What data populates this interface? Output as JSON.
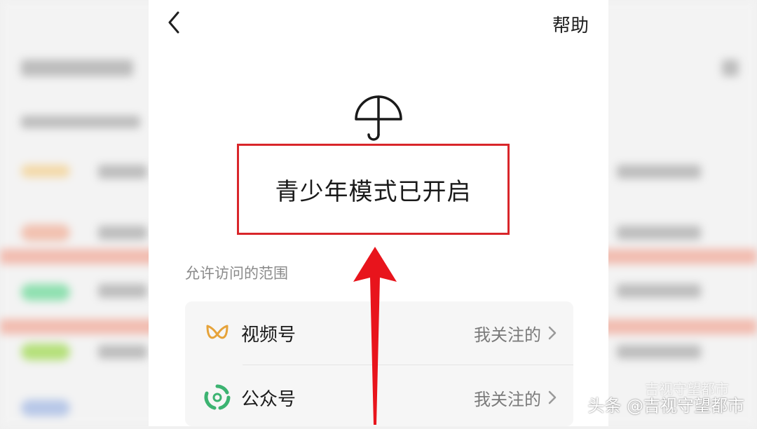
{
  "header": {
    "help_label": "帮助"
  },
  "status": {
    "text": "青少年模式已开启"
  },
  "scope": {
    "label": "允许访问的范围",
    "items": [
      {
        "label": "视频号",
        "value": "我关注的"
      },
      {
        "label": "公众号",
        "value": "我关注的"
      }
    ]
  },
  "icons": {
    "back": "chevron-left-icon",
    "umbrella": "umbrella-icon",
    "channels": "channels-icon",
    "official_accounts": "official-accounts-icon",
    "chevron": "chevron-right-icon"
  },
  "colors": {
    "highlight": "#d9262a",
    "arrow": "#e8141c",
    "channels_icon": "#e6a33a",
    "official_icon": "#3cb371"
  },
  "watermark": {
    "text": "头条 @吉视守望都市",
    "ghost": "吉视守望都市"
  }
}
